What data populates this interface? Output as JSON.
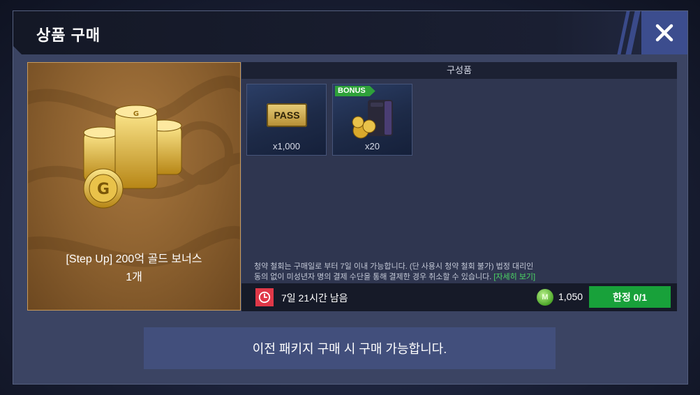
{
  "header": {
    "title": "상품 구매"
  },
  "product": {
    "name": "[Step Up] 200억 골드 보너스",
    "quantity": "1개"
  },
  "contents": {
    "header": "구성품",
    "items": [
      {
        "icon": "pass-ticket-icon",
        "ticket_label": "PASS",
        "qty": "x1,000",
        "bonus": ""
      },
      {
        "icon": "gold-coins-bag-icon",
        "ticket_label": "",
        "qty": "x20",
        "bonus": "BONUS"
      }
    ]
  },
  "notice": {
    "line1": "청약 철회는 구매일로 부터 7일 이내 가능합니다. (단 사용시 청약 철회 불가) 법정 대리인",
    "line2": "동의 없이 미성년자 명의 결제 수단을 통해 결제한 경우 취소할 수 있습니다.",
    "link": "[자세히 보기]"
  },
  "status": {
    "time_left": "7일 21시간 남음",
    "currency_symbol": "M",
    "price": "1,050",
    "limit_label": "한정 0/1"
  },
  "bottom_notice": "이전 패키지 구매 시 구매 가능합니다.",
  "colors": {
    "accent_green": "#18a13a",
    "link_green": "#4cd964",
    "clock_red": "#e03848",
    "close_blue": "#3c4d8e"
  }
}
